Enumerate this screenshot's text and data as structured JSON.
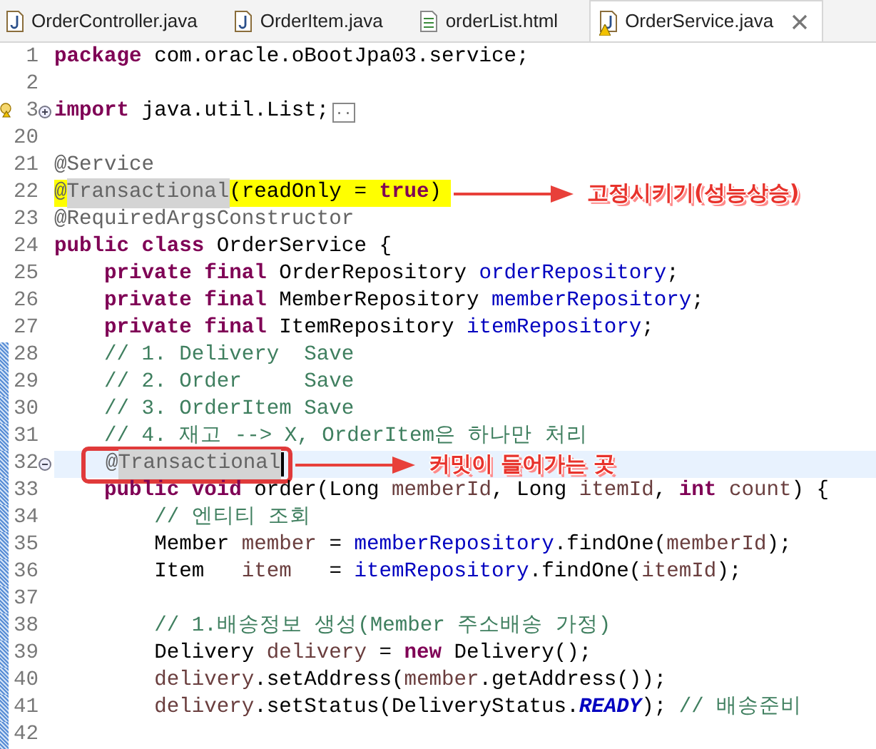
{
  "tabs": [
    {
      "label": "OrderController.java",
      "kind": "java",
      "selected": false
    },
    {
      "label": "OrderItem.java",
      "kind": "java",
      "selected": false
    },
    {
      "label": "orderList.html",
      "kind": "html",
      "selected": false
    },
    {
      "label": "OrderService.java",
      "kind": "java",
      "selected": true,
      "warning": true
    }
  ],
  "lines": [
    {
      "number": "1",
      "tokens": [
        {
          "text": "package",
          "kind": "keyword"
        },
        {
          "text": " com.oracle.oBootJpa03.service;",
          "kind": "plain"
        }
      ]
    },
    {
      "number": "2"
    },
    {
      "number": "3",
      "warning": true,
      "folded": true,
      "tokens": [
        {
          "text": "import",
          "kind": "keyword"
        },
        {
          "text": " java.util.List;",
          "kind": "plain"
        },
        {
          "text": "..",
          "kind": "collapsed"
        }
      ]
    },
    {
      "number": "20"
    },
    {
      "number": "21",
      "tokens": [
        {
          "text": "@Service",
          "kind": "annotation"
        }
      ]
    },
    {
      "number": "22",
      "highlight": true,
      "callout": "고정시키기(성능상승)",
      "tokens": [
        {
          "text": "@",
          "kind": "annotation"
        },
        {
          "text": "Transactional",
          "kind": "occurrence"
        },
        {
          "text": "(readOnly = ",
          "kind": "plain"
        },
        {
          "text": "true",
          "kind": "keyword"
        },
        {
          "text": ")",
          "kind": "plain"
        }
      ]
    },
    {
      "number": "23",
      "tokens": [
        {
          "text": "@RequiredArgsConstructor",
          "kind": "annotation"
        }
      ]
    },
    {
      "number": "24",
      "tokens": [
        {
          "text": "public class",
          "kind": "keyword"
        },
        {
          "text": " OrderService {",
          "kind": "plain"
        }
      ]
    },
    {
      "number": "25",
      "tokens": [
        {
          "text": "    private final",
          "kind": "keyword"
        },
        {
          "text": " OrderRepository ",
          "kind": "plain"
        },
        {
          "text": "orderRepository",
          "kind": "field"
        },
        {
          "text": ";",
          "kind": "plain"
        }
      ]
    },
    {
      "number": "26",
      "tokens": [
        {
          "text": "    private final",
          "kind": "keyword"
        },
        {
          "text": " MemberRepository ",
          "kind": "plain"
        },
        {
          "text": "memberRepository",
          "kind": "field"
        },
        {
          "text": ";",
          "kind": "plain"
        }
      ]
    },
    {
      "number": "27",
      "tokens": [
        {
          "text": "    private final",
          "kind": "keyword"
        },
        {
          "text": " ItemRepository ",
          "kind": "plain"
        },
        {
          "text": "itemRepository",
          "kind": "field"
        },
        {
          "text": ";",
          "kind": "plain"
        }
      ]
    },
    {
      "number": "28",
      "changed": true,
      "tokens": [
        {
          "text": "    // 1. Delivery  Save",
          "kind": "comment"
        }
      ]
    },
    {
      "number": "29",
      "changed": true,
      "tokens": [
        {
          "text": "    // 2. Order     Save",
          "kind": "comment"
        }
      ]
    },
    {
      "number": "30",
      "changed": true,
      "tokens": [
        {
          "text": "    // 3. OrderItem Save",
          "kind": "comment"
        }
      ]
    },
    {
      "number": "31",
      "changed": true,
      "tokens": [
        {
          "text": "    // 4. 재고 --> X, OrderItem은 하나만 처리",
          "kind": "comment"
        }
      ]
    },
    {
      "number": "32",
      "changed": true,
      "current": true,
      "folded": false,
      "boxed": true,
      "callout": "커밋이 들어가는 곳",
      "tokens": [
        {
          "text": "    @",
          "kind": "annotation"
        },
        {
          "text": "Transactional",
          "kind": "occurrence"
        }
      ]
    },
    {
      "number": "33",
      "changed": true,
      "tokens": [
        {
          "text": "    public void",
          "kind": "keyword"
        },
        {
          "text": " order(Long ",
          "kind": "plain"
        },
        {
          "text": "memberId",
          "kind": "variable"
        },
        {
          "text": ", Long ",
          "kind": "plain"
        },
        {
          "text": "itemId",
          "kind": "variable"
        },
        {
          "text": ", ",
          "kind": "plain"
        },
        {
          "text": "int",
          "kind": "keyword"
        },
        {
          "text": " count",
          "kind": "variable"
        },
        {
          "text": ") {",
          "kind": "plain"
        }
      ]
    },
    {
      "number": "34",
      "changed": true,
      "tokens": [
        {
          "text": "        // 엔티티 조회",
          "kind": "comment"
        }
      ]
    },
    {
      "number": "35",
      "changed": true,
      "tokens": [
        {
          "text": "        Member ",
          "kind": "plain"
        },
        {
          "text": "member",
          "kind": "variable"
        },
        {
          "text": " = ",
          "kind": "plain"
        },
        {
          "text": "memberRepository",
          "kind": "field"
        },
        {
          "text": ".findOne(",
          "kind": "plain"
        },
        {
          "text": "memberId",
          "kind": "variable"
        },
        {
          "text": ");",
          "kind": "plain"
        }
      ]
    },
    {
      "number": "36",
      "changed": true,
      "tokens": [
        {
          "text": "        Item   ",
          "kind": "plain"
        },
        {
          "text": "item",
          "kind": "variable"
        },
        {
          "text": "   = ",
          "kind": "plain"
        },
        {
          "text": "itemRepository",
          "kind": "field"
        },
        {
          "text": ".findOne(",
          "kind": "plain"
        },
        {
          "text": "itemId",
          "kind": "variable"
        },
        {
          "text": ");",
          "kind": "plain"
        }
      ]
    },
    {
      "number": "37",
      "changed": true
    },
    {
      "number": "38",
      "changed": true,
      "tokens": [
        {
          "text": "        // 1.배송정보 생성(Member 주소배송 가정)",
          "kind": "comment"
        }
      ]
    },
    {
      "number": "39",
      "changed": true,
      "tokens": [
        {
          "text": "        Delivery ",
          "kind": "plain"
        },
        {
          "text": "delivery",
          "kind": "variable"
        },
        {
          "text": " = ",
          "kind": "plain"
        },
        {
          "text": "new",
          "kind": "keyword"
        },
        {
          "text": " Delivery();",
          "kind": "plain"
        }
      ]
    },
    {
      "number": "40",
      "changed": true,
      "tokens": [
        {
          "text": "        delivery",
          "kind": "variable"
        },
        {
          "text": ".setAddress(",
          "kind": "plain"
        },
        {
          "text": "member",
          "kind": "variable"
        },
        {
          "text": ".getAddress());",
          "kind": "plain"
        }
      ]
    },
    {
      "number": "41",
      "changed": true,
      "tokens": [
        {
          "text": "        delivery",
          "kind": "variable"
        },
        {
          "text": ".setStatus(DeliveryStatus.",
          "kind": "plain"
        },
        {
          "text": "READY",
          "kind": "constant"
        },
        {
          "text": "); ",
          "kind": "plain"
        },
        {
          "text": "// 배송준비",
          "kind": "comment"
        }
      ]
    },
    {
      "number": "42",
      "changed": true
    }
  ]
}
